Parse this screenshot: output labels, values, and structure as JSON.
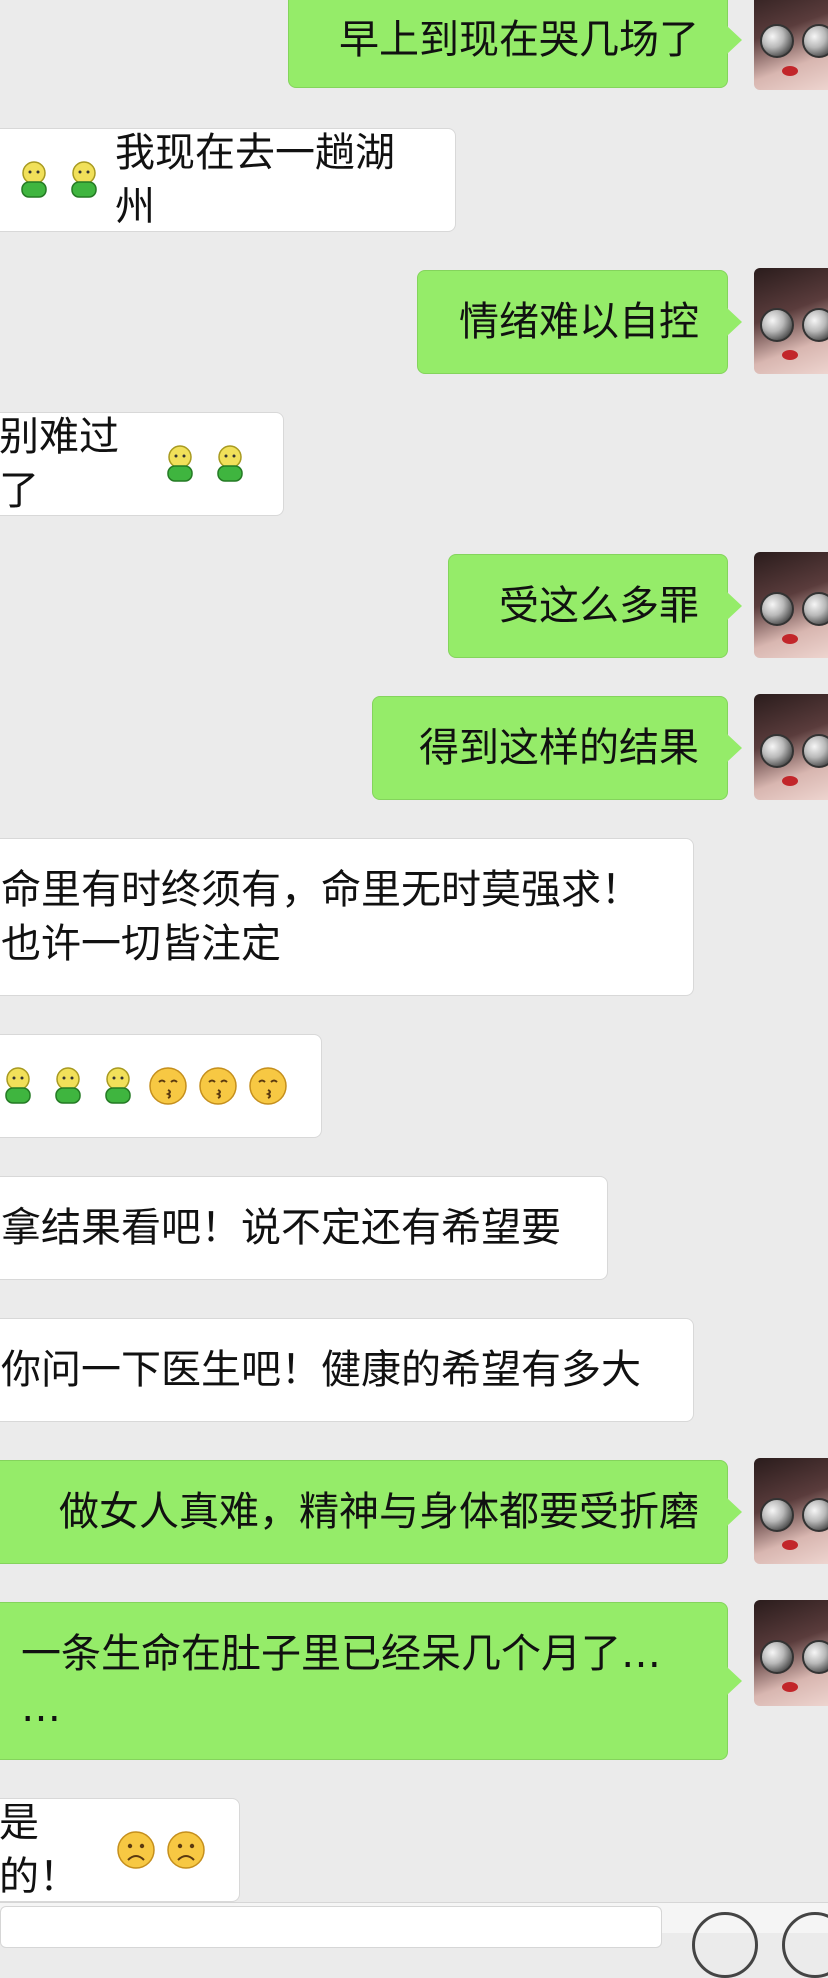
{
  "messages": [
    {
      "id": "m1",
      "side": "out",
      "text": "早上到现在哭几场了",
      "emoji_before": [],
      "emoji_after": []
    },
    {
      "id": "m2",
      "side": "in",
      "text": "我现在去一趟湖州",
      "emoji_before": [
        "green-figure",
        "green-figure"
      ],
      "emoji_after": []
    },
    {
      "id": "m3",
      "side": "out",
      "text": "情绪难以自控",
      "emoji_before": [],
      "emoji_after": []
    },
    {
      "id": "m4",
      "side": "in",
      "text": "别难过了",
      "emoji_before": [],
      "emoji_after": [
        "green-figure",
        "green-figure"
      ]
    },
    {
      "id": "m5",
      "side": "out",
      "text": "受这么多罪",
      "emoji_before": [],
      "emoji_after": []
    },
    {
      "id": "m6",
      "side": "out",
      "text": "得到这样的结果",
      "emoji_before": [],
      "emoji_after": []
    },
    {
      "id": "m7",
      "side": "in",
      "text": "命里有时终须有，命里无时莫强求！\n也许一切皆注定",
      "emoji_before": [],
      "emoji_after": []
    },
    {
      "id": "m8",
      "side": "in",
      "text": "",
      "emoji_before": [
        "green-figure",
        "green-figure",
        "green-figure",
        "kiss-face",
        "kiss-face",
        "kiss-face"
      ],
      "emoji_after": []
    },
    {
      "id": "m9",
      "side": "in",
      "text": "拿结果看吧！说不定还有希望要",
      "emoji_before": [],
      "emoji_after": []
    },
    {
      "id": "m10",
      "side": "in",
      "text": "你问一下医生吧！健康的希望有多大",
      "emoji_before": [],
      "emoji_after": []
    },
    {
      "id": "m11",
      "side": "out",
      "text": "做女人真难，精神与身体都要受折磨",
      "emoji_before": [],
      "emoji_after": []
    },
    {
      "id": "m12",
      "side": "out",
      "text": "一条生命在肚子里已经呆几个月了…\n…",
      "emoji_before": [],
      "emoji_after": []
    },
    {
      "id": "m13",
      "side": "in",
      "text": "是的！",
      "emoji_before": [],
      "emoji_after": [
        "sad-face",
        "sad-face"
      ]
    }
  ],
  "colors": {
    "bubble_out": "#95ec69",
    "bubble_in": "#ffffff",
    "background": "#ebebeb"
  }
}
